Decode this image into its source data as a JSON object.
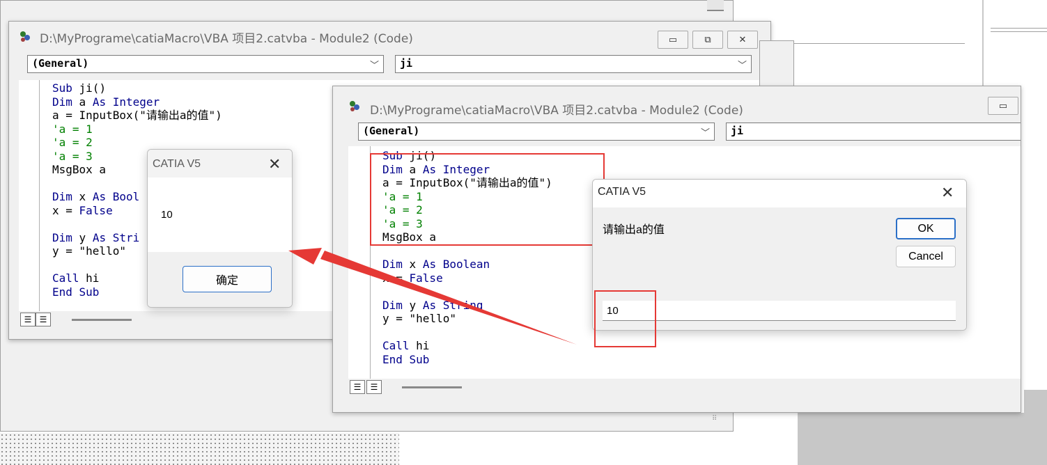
{
  "back_window": {
    "title": "D:\\MyPrograme\\catiaMacro\\VBA 项目2.catvba - Module2 (Code)",
    "combo_left": "(General)",
    "combo_right": "ji",
    "buttons": [
      "▭",
      "⧉",
      "✕"
    ],
    "code_lines": [
      {
        "parts": [
          {
            "t": "Sub",
            "c": "kw"
          },
          {
            "t": " ji()",
            "c": "tx"
          }
        ]
      },
      {
        "parts": [
          {
            "t": "Dim",
            "c": "kw"
          },
          {
            "t": " a ",
            "c": "tx"
          },
          {
            "t": "As Integer",
            "c": "kw"
          }
        ]
      },
      {
        "parts": [
          {
            "t": "a = InputBox(\"请输出a的值\")",
            "c": "tx"
          }
        ]
      },
      {
        "parts": [
          {
            "t": "'a = 1",
            "c": "cm"
          }
        ]
      },
      {
        "parts": [
          {
            "t": "'a = 2",
            "c": "cm"
          }
        ]
      },
      {
        "parts": [
          {
            "t": "'a = 3",
            "c": "cm"
          }
        ]
      },
      {
        "parts": [
          {
            "t": "MsgBox a",
            "c": "tx"
          }
        ]
      },
      {
        "parts": [
          {
            "t": "",
            "c": "tx"
          }
        ]
      },
      {
        "parts": [
          {
            "t": "Dim",
            "c": "kw"
          },
          {
            "t": " x ",
            "c": "tx"
          },
          {
            "t": "As Bool",
            "c": "kw"
          }
        ]
      },
      {
        "parts": [
          {
            "t": "x = ",
            "c": "tx"
          },
          {
            "t": "False",
            "c": "kw"
          }
        ]
      },
      {
        "parts": [
          {
            "t": "",
            "c": "tx"
          }
        ]
      },
      {
        "parts": [
          {
            "t": "Dim",
            "c": "kw"
          },
          {
            "t": " y ",
            "c": "tx"
          },
          {
            "t": "As Stri",
            "c": "kw"
          }
        ]
      },
      {
        "parts": [
          {
            "t": "y = \"hello\"",
            "c": "tx"
          }
        ]
      },
      {
        "parts": [
          {
            "t": "",
            "c": "tx"
          }
        ]
      },
      {
        "parts": [
          {
            "t": "Call",
            "c": "kw"
          },
          {
            "t": " hi",
            "c": "tx"
          }
        ]
      },
      {
        "parts": [
          {
            "t": "End Sub",
            "c": "kw"
          }
        ]
      }
    ]
  },
  "front_window": {
    "title": "D:\\MyPrograme\\catiaMacro\\VBA 项目2.catvba - Module2 (Code)",
    "combo_left": "(General)",
    "combo_right": "ji",
    "button": "▭",
    "code_lines": [
      {
        "parts": [
          {
            "t": "Sub",
            "c": "kw"
          },
          {
            "t": " ji()",
            "c": "tx"
          }
        ]
      },
      {
        "parts": [
          {
            "t": "Dim",
            "c": "kw"
          },
          {
            "t": " a ",
            "c": "tx"
          },
          {
            "t": "As Integer",
            "c": "kw"
          }
        ]
      },
      {
        "parts": [
          {
            "t": "a = InputBox(\"请输出a的值\")",
            "c": "tx"
          }
        ]
      },
      {
        "parts": [
          {
            "t": "'a = 1",
            "c": "cm"
          }
        ]
      },
      {
        "parts": [
          {
            "t": "'a = 2",
            "c": "cm"
          }
        ]
      },
      {
        "parts": [
          {
            "t": "'a = 3",
            "c": "cm"
          }
        ]
      },
      {
        "parts": [
          {
            "t": "MsgBox a",
            "c": "tx"
          }
        ]
      },
      {
        "parts": [
          {
            "t": "",
            "c": "tx"
          }
        ]
      },
      {
        "parts": [
          {
            "t": "Dim",
            "c": "kw"
          },
          {
            "t": " x ",
            "c": "tx"
          },
          {
            "t": "As Boolean",
            "c": "kw"
          }
        ]
      },
      {
        "parts": [
          {
            "t": "x = ",
            "c": "tx"
          },
          {
            "t": "False",
            "c": "kw"
          }
        ]
      },
      {
        "parts": [
          {
            "t": "",
            "c": "tx"
          }
        ]
      },
      {
        "parts": [
          {
            "t": "Dim",
            "c": "kw"
          },
          {
            "t": " y ",
            "c": "tx"
          },
          {
            "t": "As String",
            "c": "kw"
          }
        ]
      },
      {
        "parts": [
          {
            "t": "y = \"hello\"",
            "c": "tx"
          }
        ]
      },
      {
        "parts": [
          {
            "t": "",
            "c": "tx"
          }
        ]
      },
      {
        "parts": [
          {
            "t": "Call",
            "c": "kw"
          },
          {
            "t": " hi",
            "c": "tx"
          }
        ]
      },
      {
        "parts": [
          {
            "t": "End Sub",
            "c": "kw"
          }
        ]
      }
    ]
  },
  "msgbox": {
    "title": "CATIA V5",
    "close": "✕",
    "message": "10",
    "ok_label": "确定"
  },
  "inputbox": {
    "title": "CATIA V5",
    "close": "✕",
    "prompt": "请输出a的值",
    "ok_label": "OK",
    "cancel_label": "Cancel",
    "input_value": "10"
  },
  "colors": {
    "annotation": "#e53935",
    "keyword": "#00008b",
    "comment": "#008000"
  }
}
